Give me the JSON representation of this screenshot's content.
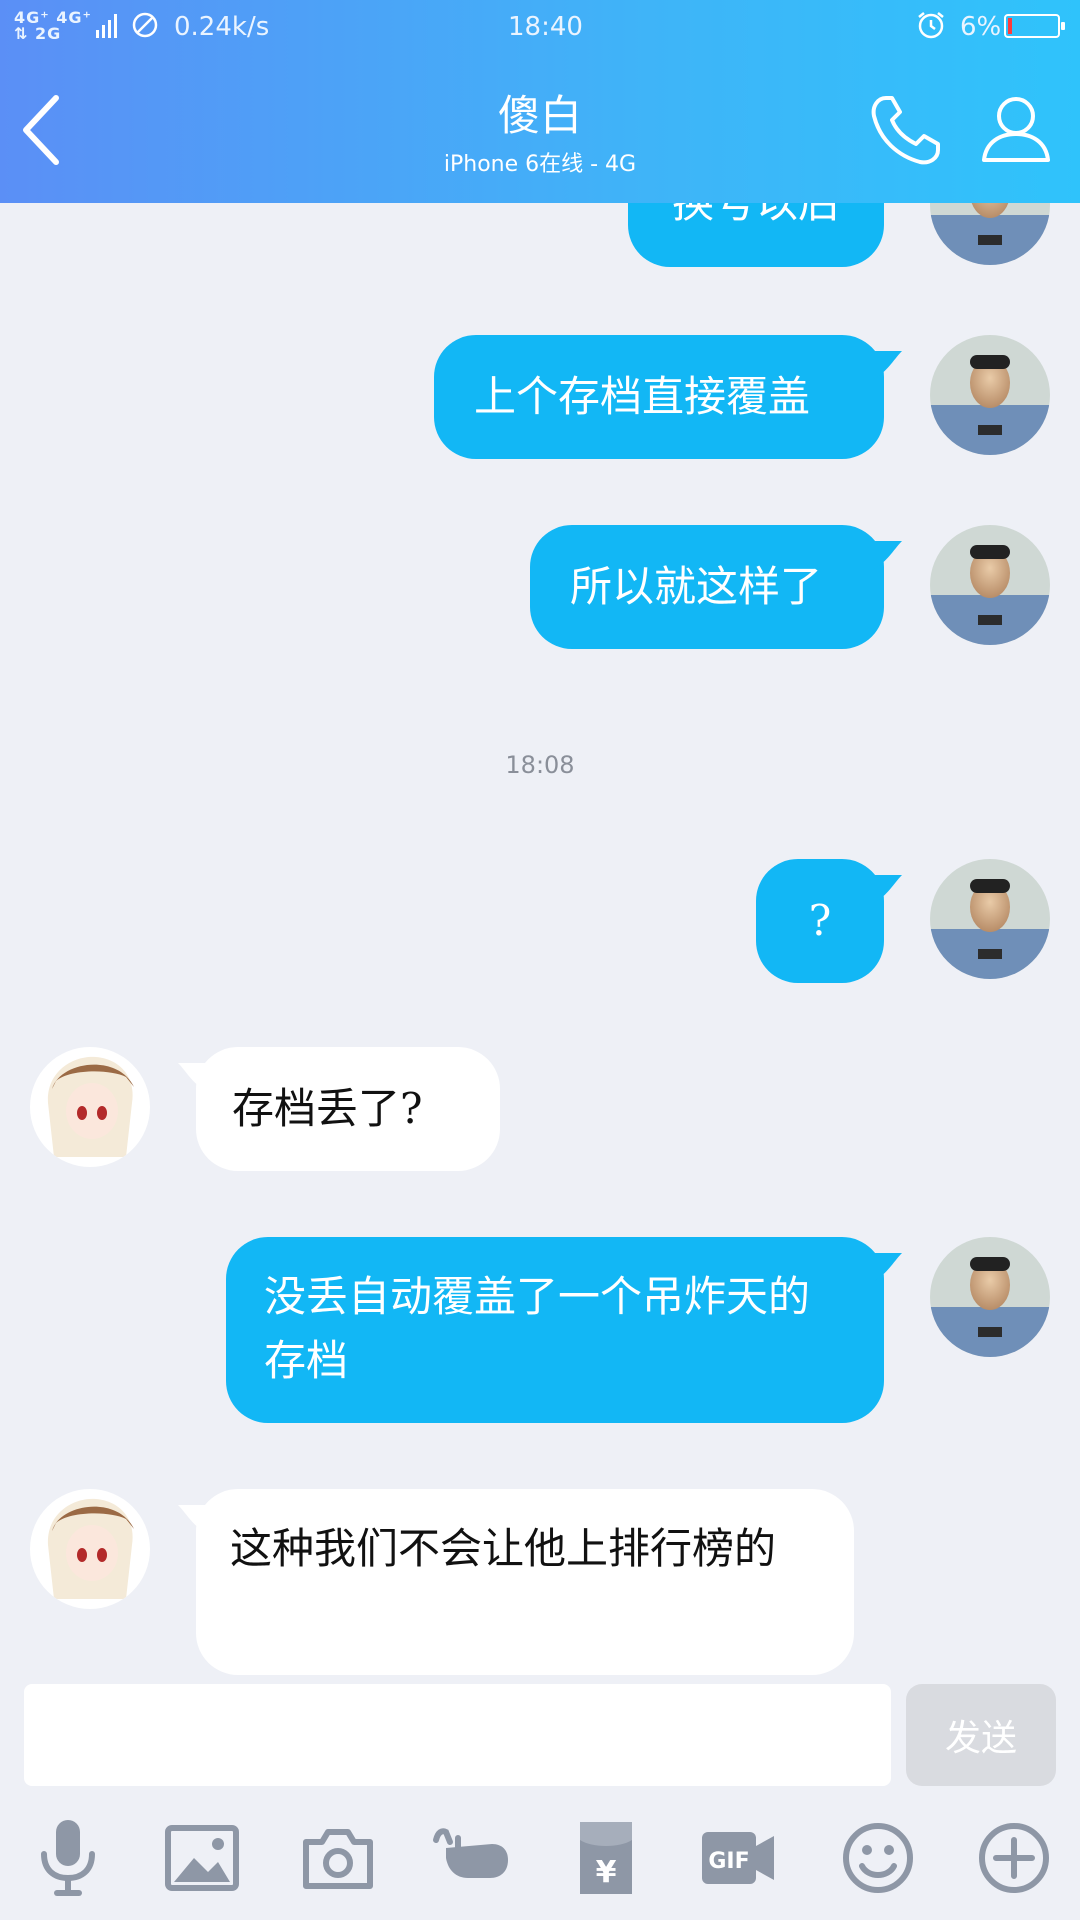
{
  "status_bar": {
    "signal_text": "4G⁺ 4G⁺\n⇅ 2G",
    "network_speed": "0.24k/s",
    "time": "18:40",
    "battery_percent": "6%",
    "battery_level": 0.06
  },
  "header": {
    "title": "傻白",
    "subtitle": "iPhone 6在线 - 4G"
  },
  "messages": [
    {
      "direction": "out",
      "text": "换号以后"
    },
    {
      "direction": "out",
      "text": "上个存档直接覆盖"
    },
    {
      "direction": "out",
      "text": "所以就这样了"
    },
    {
      "direction": "out",
      "text": "?"
    },
    {
      "direction": "in",
      "text": "存档丢了?"
    },
    {
      "direction": "out",
      "text": "没丢自动覆盖了一个吊炸天的存档"
    },
    {
      "direction": "in",
      "text": "这种我们不会让他上排行榜的"
    }
  ],
  "timestamp": "18:08",
  "input": {
    "value": "",
    "send_label": "发送"
  },
  "toolbar": {
    "gif_label": "GIF",
    "icons": [
      "microphone-icon",
      "image-icon",
      "camera-icon",
      "poke-hand-icon",
      "red-packet-icon",
      "gif-icon",
      "emoji-icon",
      "plus-icon"
    ]
  },
  "colors": {
    "header_gradient_start": "#5b8ff6",
    "header_gradient_end": "#2fc3fb",
    "outgoing_bubble": "#12b7f5",
    "incoming_bubble": "#ffffff",
    "chat_background": "#eef0f6",
    "battery_low": "#ff3b3b"
  }
}
